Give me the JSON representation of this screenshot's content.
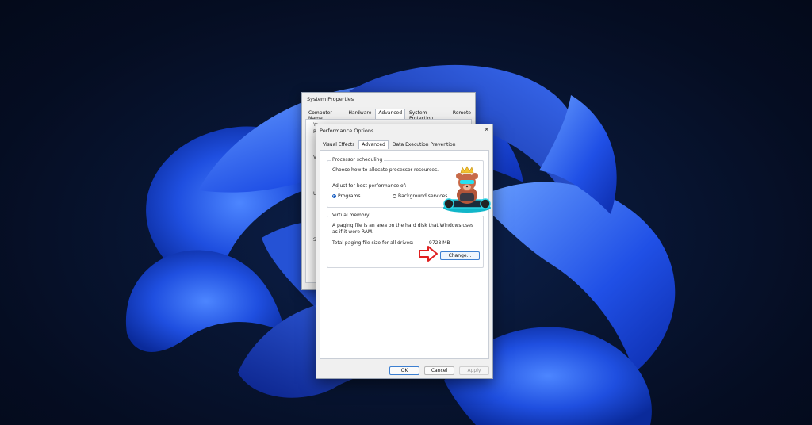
{
  "system_properties": {
    "title": "System Properties",
    "tabs": [
      "Computer Name",
      "Hardware",
      "Advanced",
      "System Protection",
      "Remote"
    ],
    "active_tab": 2,
    "fragments": [
      "Yo",
      "P",
      "V",
      "U",
      "S"
    ]
  },
  "performance_options": {
    "title": "Performance Options",
    "close_glyph": "✕",
    "tabs": [
      "Visual Effects",
      "Advanced",
      "Data Execution Prevention"
    ],
    "active_tab": 1,
    "processor_scheduling": {
      "legend": "Processor scheduling",
      "description": "Choose how to allocate processor resources.",
      "adjust_label": "Adjust for best performance of:",
      "options": [
        {
          "label": "Programs",
          "selected": true
        },
        {
          "label": "Background services",
          "selected": false
        }
      ]
    },
    "virtual_memory": {
      "legend": "Virtual memory",
      "description": "A paging file is an area on the hard disk that Windows uses as if it were RAM.",
      "total_label": "Total paging file size for all drives:",
      "total_value": "9728 MB",
      "change_button": "Change..."
    },
    "buttons": {
      "ok": "OK",
      "cancel": "Cancel",
      "apply": "Apply"
    }
  },
  "colors": {
    "accent": "#1a5fc2",
    "arrow": "#e02020",
    "wallpaper_dark": "#050d22",
    "bloom_blue": "#1f4fe0"
  }
}
